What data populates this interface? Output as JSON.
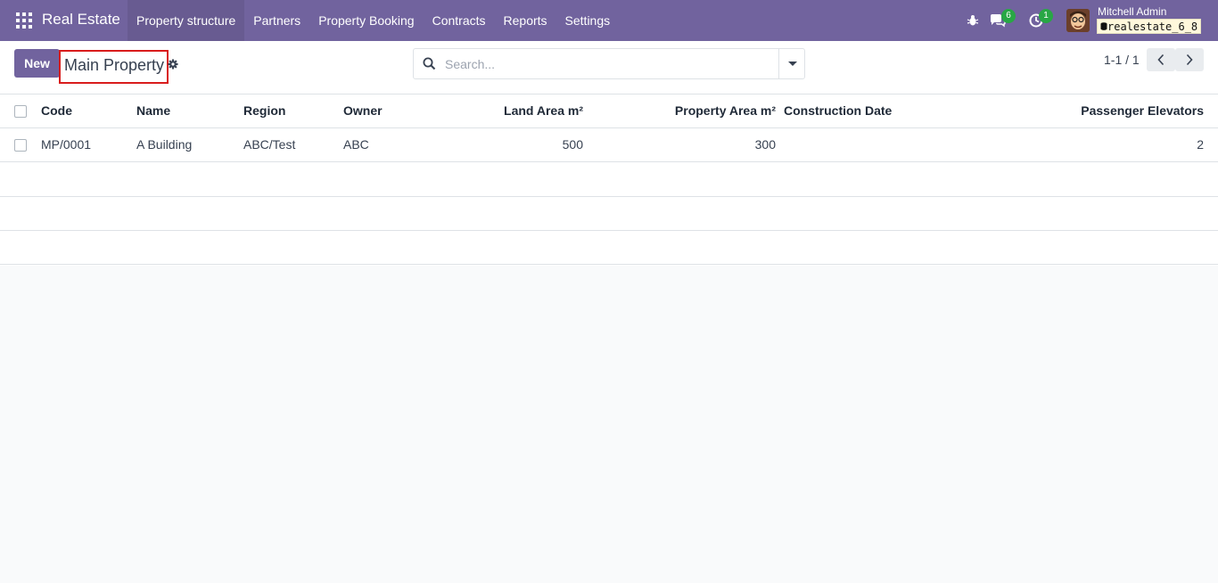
{
  "navbar": {
    "brand": "Real Estate",
    "menu": [
      "Property structure",
      "Partners",
      "Property Booking",
      "Contracts",
      "Reports",
      "Settings"
    ],
    "messages_count": "6",
    "activities_count": "1",
    "user_name": "Mitchell Admin",
    "database": "realestate_6_8",
    "color": "#71639e"
  },
  "control": {
    "new_label": "New",
    "breadcrumb": "Main Property",
    "search_placeholder": "Search...",
    "pager": "1-1 / 1"
  },
  "table": {
    "columns": [
      "Code",
      "Name",
      "Region",
      "Owner",
      "Land Area m²",
      "Property Area m²",
      "Construction Date",
      "Passenger Elevators"
    ],
    "rows": [
      [
        "MP/0001",
        "A Building",
        "ABC/Test",
        "ABC",
        "500",
        "300",
        "",
        "2"
      ]
    ]
  }
}
